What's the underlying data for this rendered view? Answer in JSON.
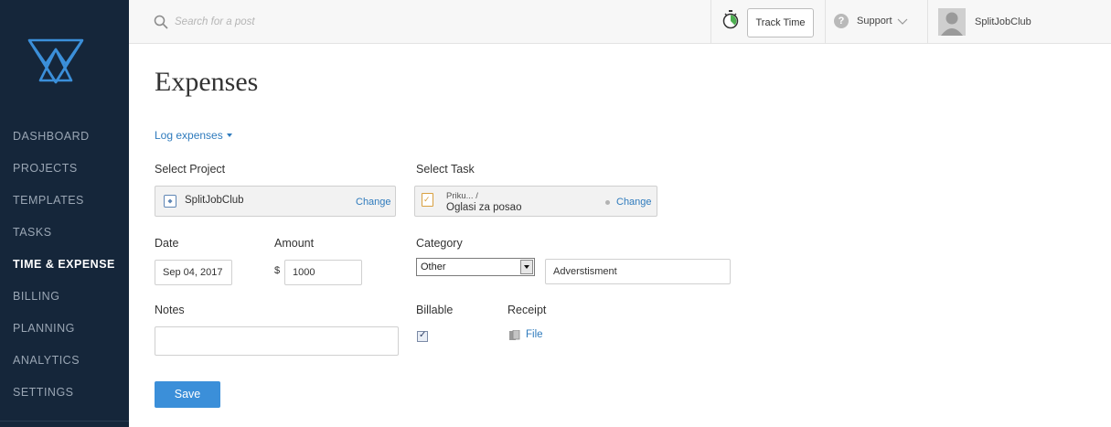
{
  "sidebar": {
    "items": [
      {
        "label": "DASHBOARD"
      },
      {
        "label": "PROJECTS"
      },
      {
        "label": "TEMPLATES"
      },
      {
        "label": "TASKS"
      },
      {
        "label": "TIME & EXPENSE",
        "active": true
      },
      {
        "label": "BILLING"
      },
      {
        "label": "PLANNING"
      },
      {
        "label": "ANALYTICS"
      },
      {
        "label": "SETTINGS"
      }
    ]
  },
  "topbar": {
    "search_placeholder": "Search for a post",
    "track_time_label": "Track Time",
    "support_label": "Support",
    "username": "SplitJobClub"
  },
  "page": {
    "title": "Expenses",
    "log_expenses_label": "Log expenses"
  },
  "form": {
    "select_project_label": "Select Project",
    "project_name": "SplitJobClub",
    "project_change_label": "Change",
    "select_task_label": "Select Task",
    "task_parent": "Priku... /",
    "task_name": "Oglasi za posao",
    "task_change_label": "Change",
    "date_label": "Date",
    "date_value": "Sep 04, 2017",
    "amount_label": "Amount",
    "currency_symbol": "$",
    "amount_value": "1000",
    "category_label": "Category",
    "category_value": "Other",
    "category_detail_value": "Adverstisment",
    "notes_label": "Notes",
    "notes_value": "",
    "billable_label": "Billable",
    "billable_checked": true,
    "receipt_label": "Receipt",
    "file_label": "File",
    "save_label": "Save"
  },
  "colors": {
    "sidebar_bg": "#15263a",
    "accent": "#3b8fd9",
    "link": "#2f7bbd",
    "logo": "#3b8fd9"
  }
}
